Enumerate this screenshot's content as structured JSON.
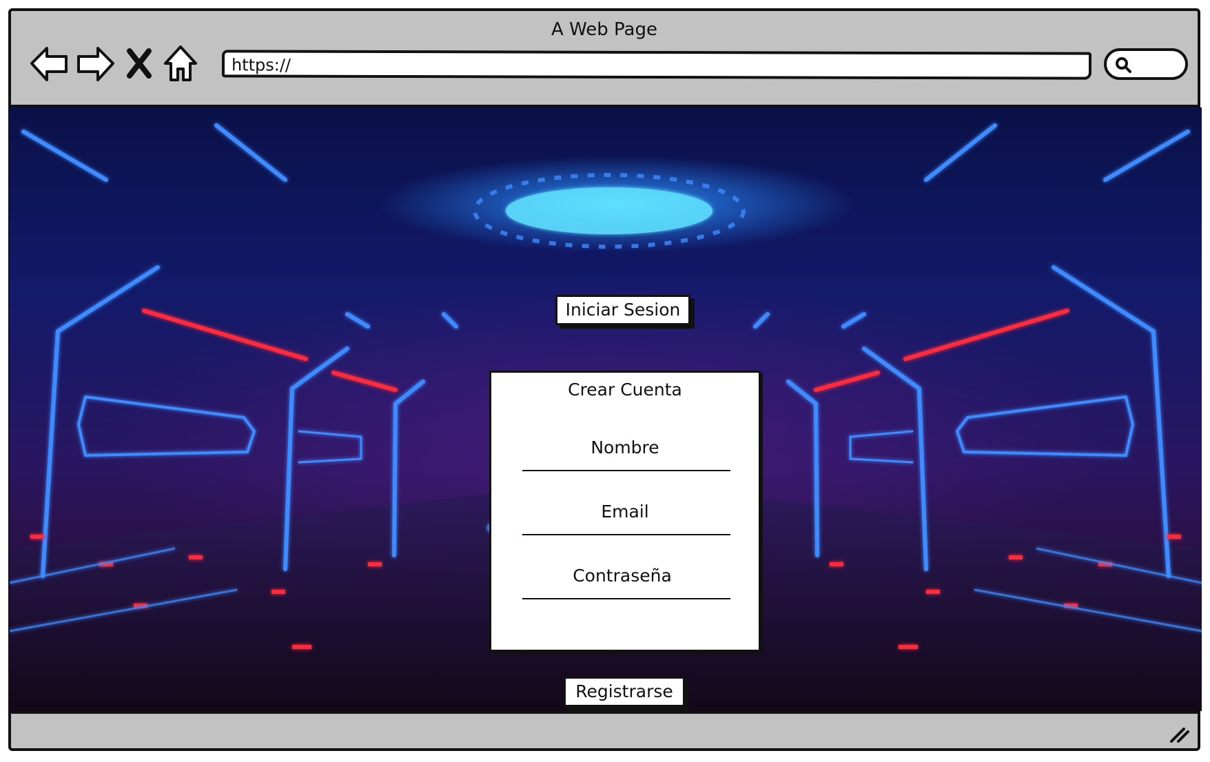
{
  "window": {
    "title": "A Web Page"
  },
  "nav": {
    "back_icon": "back-arrow-icon",
    "forward_icon": "forward-arrow-icon",
    "stop_icon": "close-icon",
    "home_icon": "home-icon"
  },
  "address_bar": {
    "value": "https://"
  },
  "search": {
    "icon": "search-icon"
  },
  "page": {
    "login_button": "Iniciar Sesion",
    "form": {
      "title": "Crear Cuenta",
      "fields": [
        {
          "label": "Nombre",
          "value": ""
        },
        {
          "label": "Email",
          "value": ""
        },
        {
          "label": "Contraseña",
          "value": ""
        }
      ]
    },
    "register_button": "Registrarse",
    "background": "neon sci-fi corridor image"
  },
  "colors": {
    "frame": "#c2c2c2",
    "neon_blue": "#3d8bff",
    "neon_red": "#ff2a3a",
    "neon_cyan": "#5ee0ff"
  }
}
